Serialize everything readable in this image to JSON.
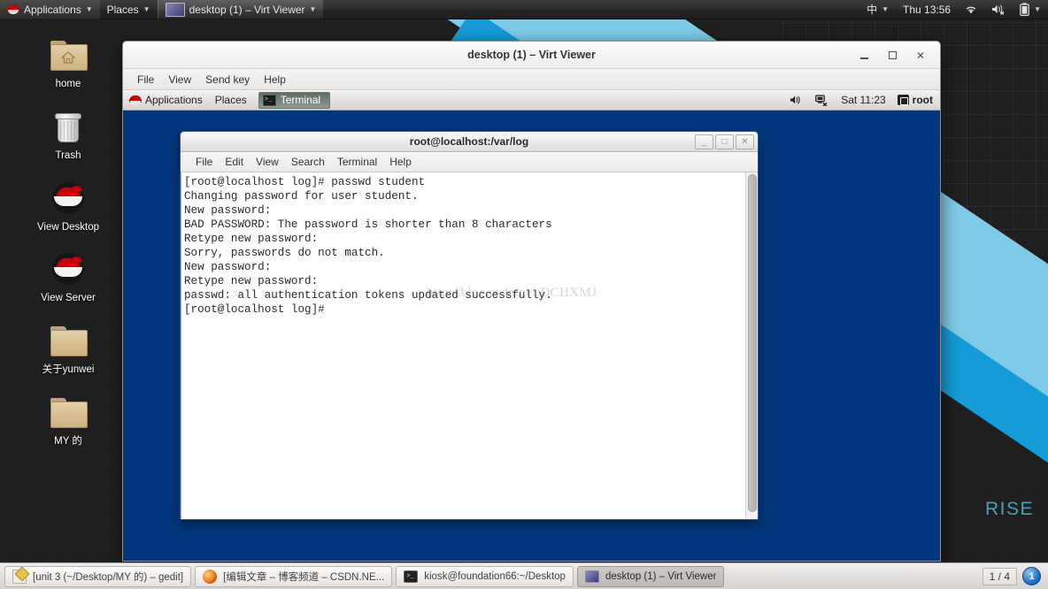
{
  "host_top_panel": {
    "applications_label": "Applications",
    "places_label": "Places",
    "window_button_label": "desktop (1) – Virt Viewer",
    "ime_label": "中",
    "clock": "Thu 13:56",
    "icons": [
      "redhat-logo-icon",
      "caret-down-icon",
      "wifi-icon",
      "volume-muted-icon",
      "battery-icon"
    ]
  },
  "desktop_icons": [
    {
      "label": "home",
      "icon": "home-folder-icon"
    },
    {
      "label": "Trash",
      "icon": "trash-icon"
    },
    {
      "label": "View Desktop",
      "icon": "redhat-icon"
    },
    {
      "label": "View Server",
      "icon": "redhat-icon"
    },
    {
      "label": "关于yunwei",
      "icon": "folder-icon"
    },
    {
      "label": "MY 的",
      "icon": "folder-icon"
    }
  ],
  "wallpaper": {
    "text": "RISE",
    "accent_light": "#7ecbe8",
    "accent_mid": "#159bd7",
    "base": "#1d1d1d"
  },
  "virt_viewer": {
    "title": "desktop (1) – Virt Viewer",
    "menu": [
      "File",
      "View",
      "Send key",
      "Help"
    ],
    "controls": [
      "minimize",
      "maximize",
      "close"
    ]
  },
  "vm_panel": {
    "applications_label": "Applications",
    "places_label": "Places",
    "task_label": "Terminal",
    "clock": "Sat 11:23",
    "user": "root",
    "icons": [
      "redhat-logo-icon",
      "volume-icon",
      "network-disconnected-icon",
      "user-icon"
    ]
  },
  "terminal": {
    "title": "root@localhost:/var/log",
    "menu": [
      "File",
      "Edit",
      "View",
      "Search",
      "Terminal",
      "Help"
    ],
    "controls": [
      "minimize",
      "maximize",
      "close"
    ],
    "content": "[root@localhost log]# passwd student\nChanging password for user student.\nNew password:\nBAD PASSWORD: The password is shorter than 8 characters\nRetype new password:\nSorry, passwords do not match.\nNew password:\nRetype new password:\npasswd: all authentication tokens updated successfully.\n[root@localhost log]#",
    "watermark": "http://blog.csdn.net/DCHXMJ"
  },
  "taskbar": {
    "buttons": [
      {
        "label": "[unit 3 (~/Desktop/MY 的) – gedit]",
        "icon": "gedit-icon",
        "active": false
      },
      {
        "label": "[编辑文章 – 博客频道 – CSDN.NE...",
        "icon": "firefox-icon",
        "active": false
      },
      {
        "label": "kiosk@foundation66:~/Desktop",
        "icon": "terminal-icon",
        "active": false
      },
      {
        "label": "desktop (1) – Virt Viewer",
        "icon": "virt-viewer-icon",
        "active": true
      }
    ],
    "workspace_count": "1 / 4",
    "workspace_current": "1"
  }
}
